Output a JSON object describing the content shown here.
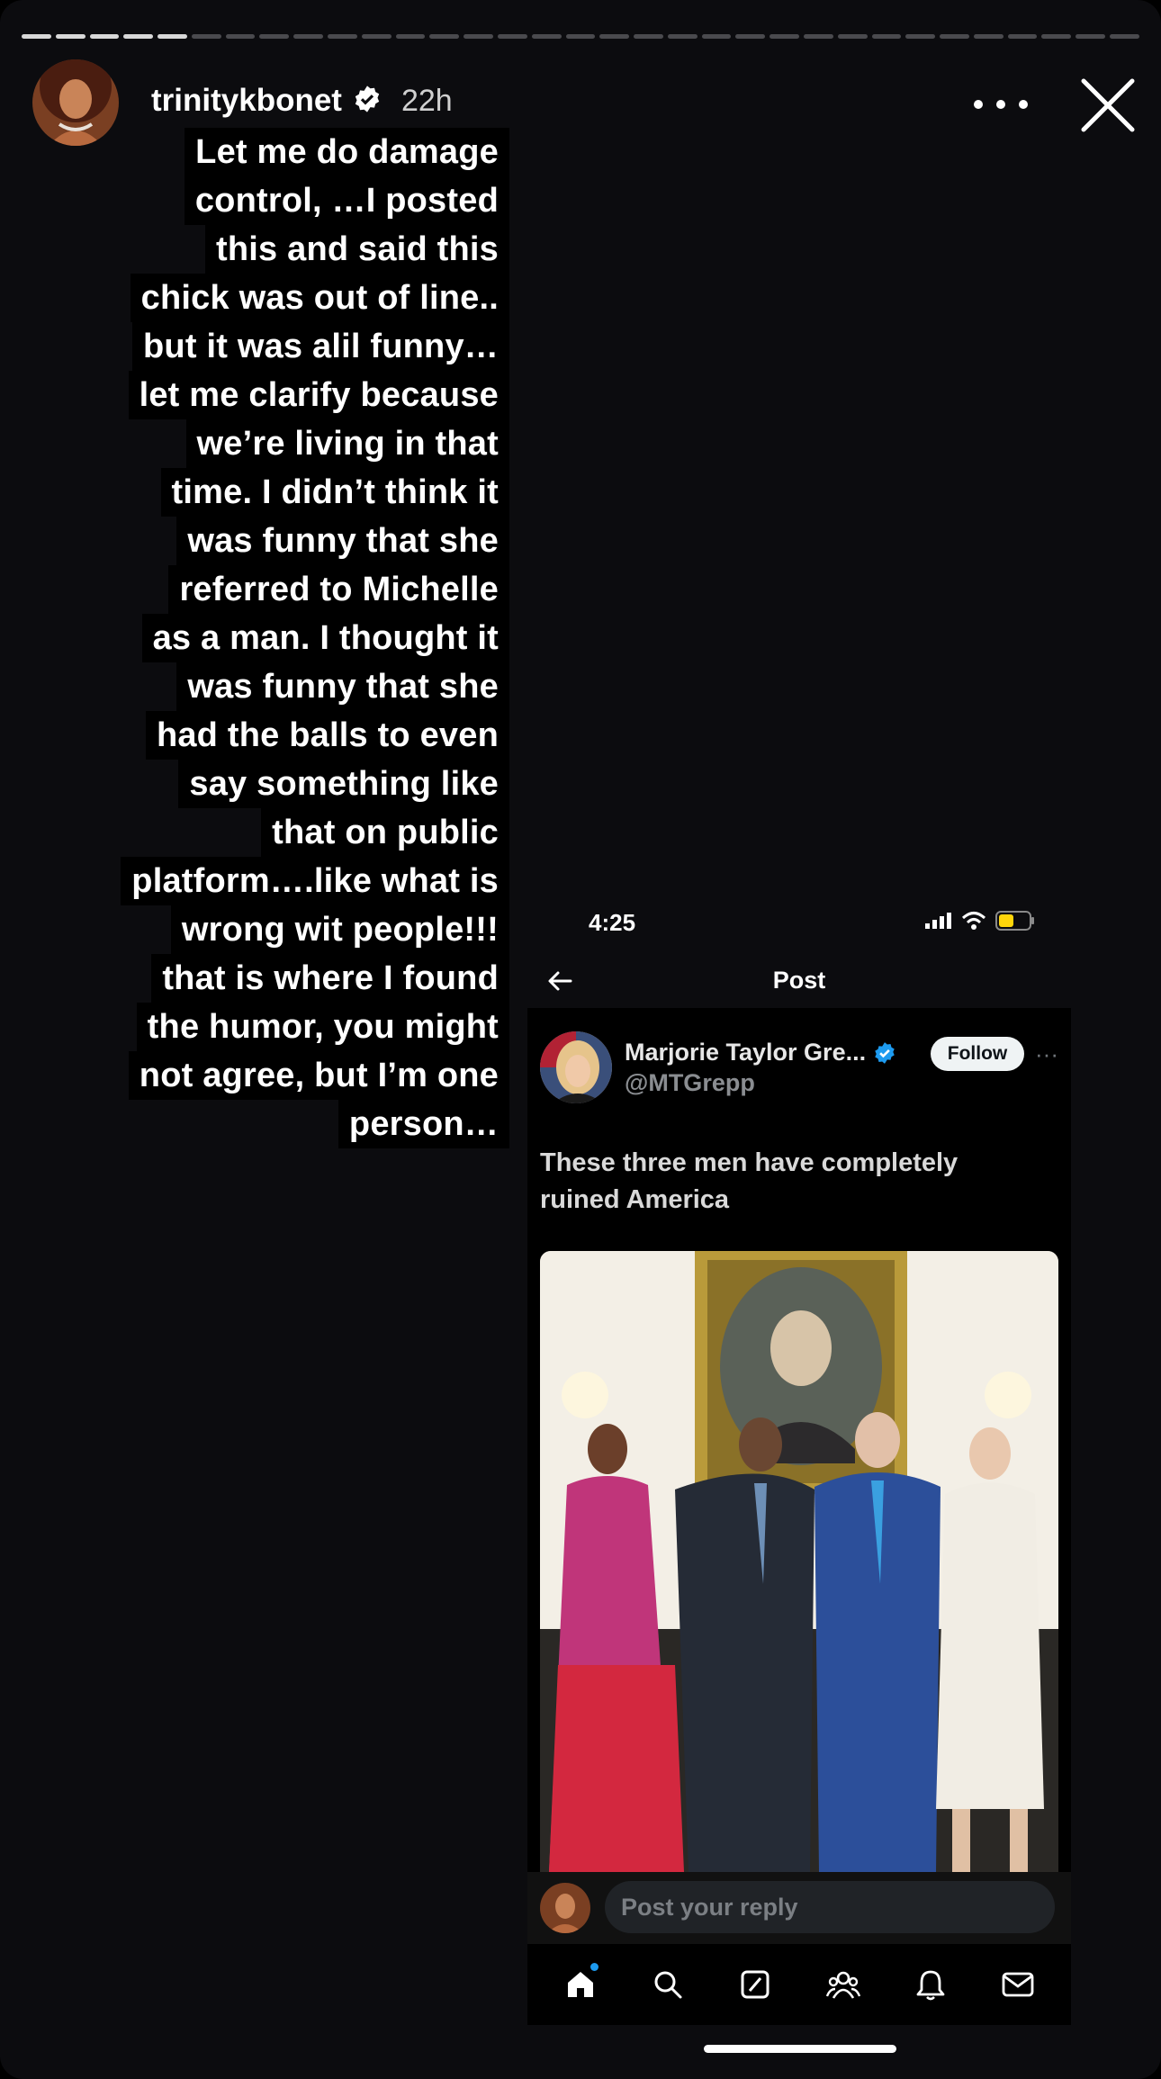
{
  "story": {
    "username": "trinitykbonet",
    "time_ago": "22h",
    "progress": {
      "segments": 33,
      "completed": 5
    },
    "caption_lines": [
      "Let me do damage",
      "control,  …I posted",
      "this and said this",
      "chick was out of line..",
      "but it was alil funny…",
      "let me clarify because",
      "we’re living in that",
      "time. I didn’t think it",
      "was funny that she",
      "referred to Michelle",
      "as a man. I thought it",
      "was funny that she",
      "had the balls to even",
      "say something like",
      "that on public",
      "platform….like what is",
      "wrong wit people!!!",
      "that is where I found",
      "the humor, you might",
      "not agree, but I’m one",
      "person…"
    ],
    "icons": {
      "more": "more-horizontal-icon",
      "close": "close-icon",
      "verified": "verified-badge-icon"
    }
  },
  "screenshot": {
    "status_time": "4:25",
    "nav_title": "Post",
    "author_name": "Marjorie Taylor Gre...",
    "author_handle": "@MTGrepp",
    "follow_label": "Follow",
    "more_label": "···",
    "tweet_text": "These three men have completely ruined America",
    "reply_placeholder": "Post your reply",
    "tabs": [
      "home-icon",
      "search-icon",
      "grok-icon",
      "communities-icon",
      "notifications-icon",
      "messages-icon"
    ],
    "colors": {
      "verified": "#1d9bf0",
      "battery": "#ffd60a"
    }
  }
}
